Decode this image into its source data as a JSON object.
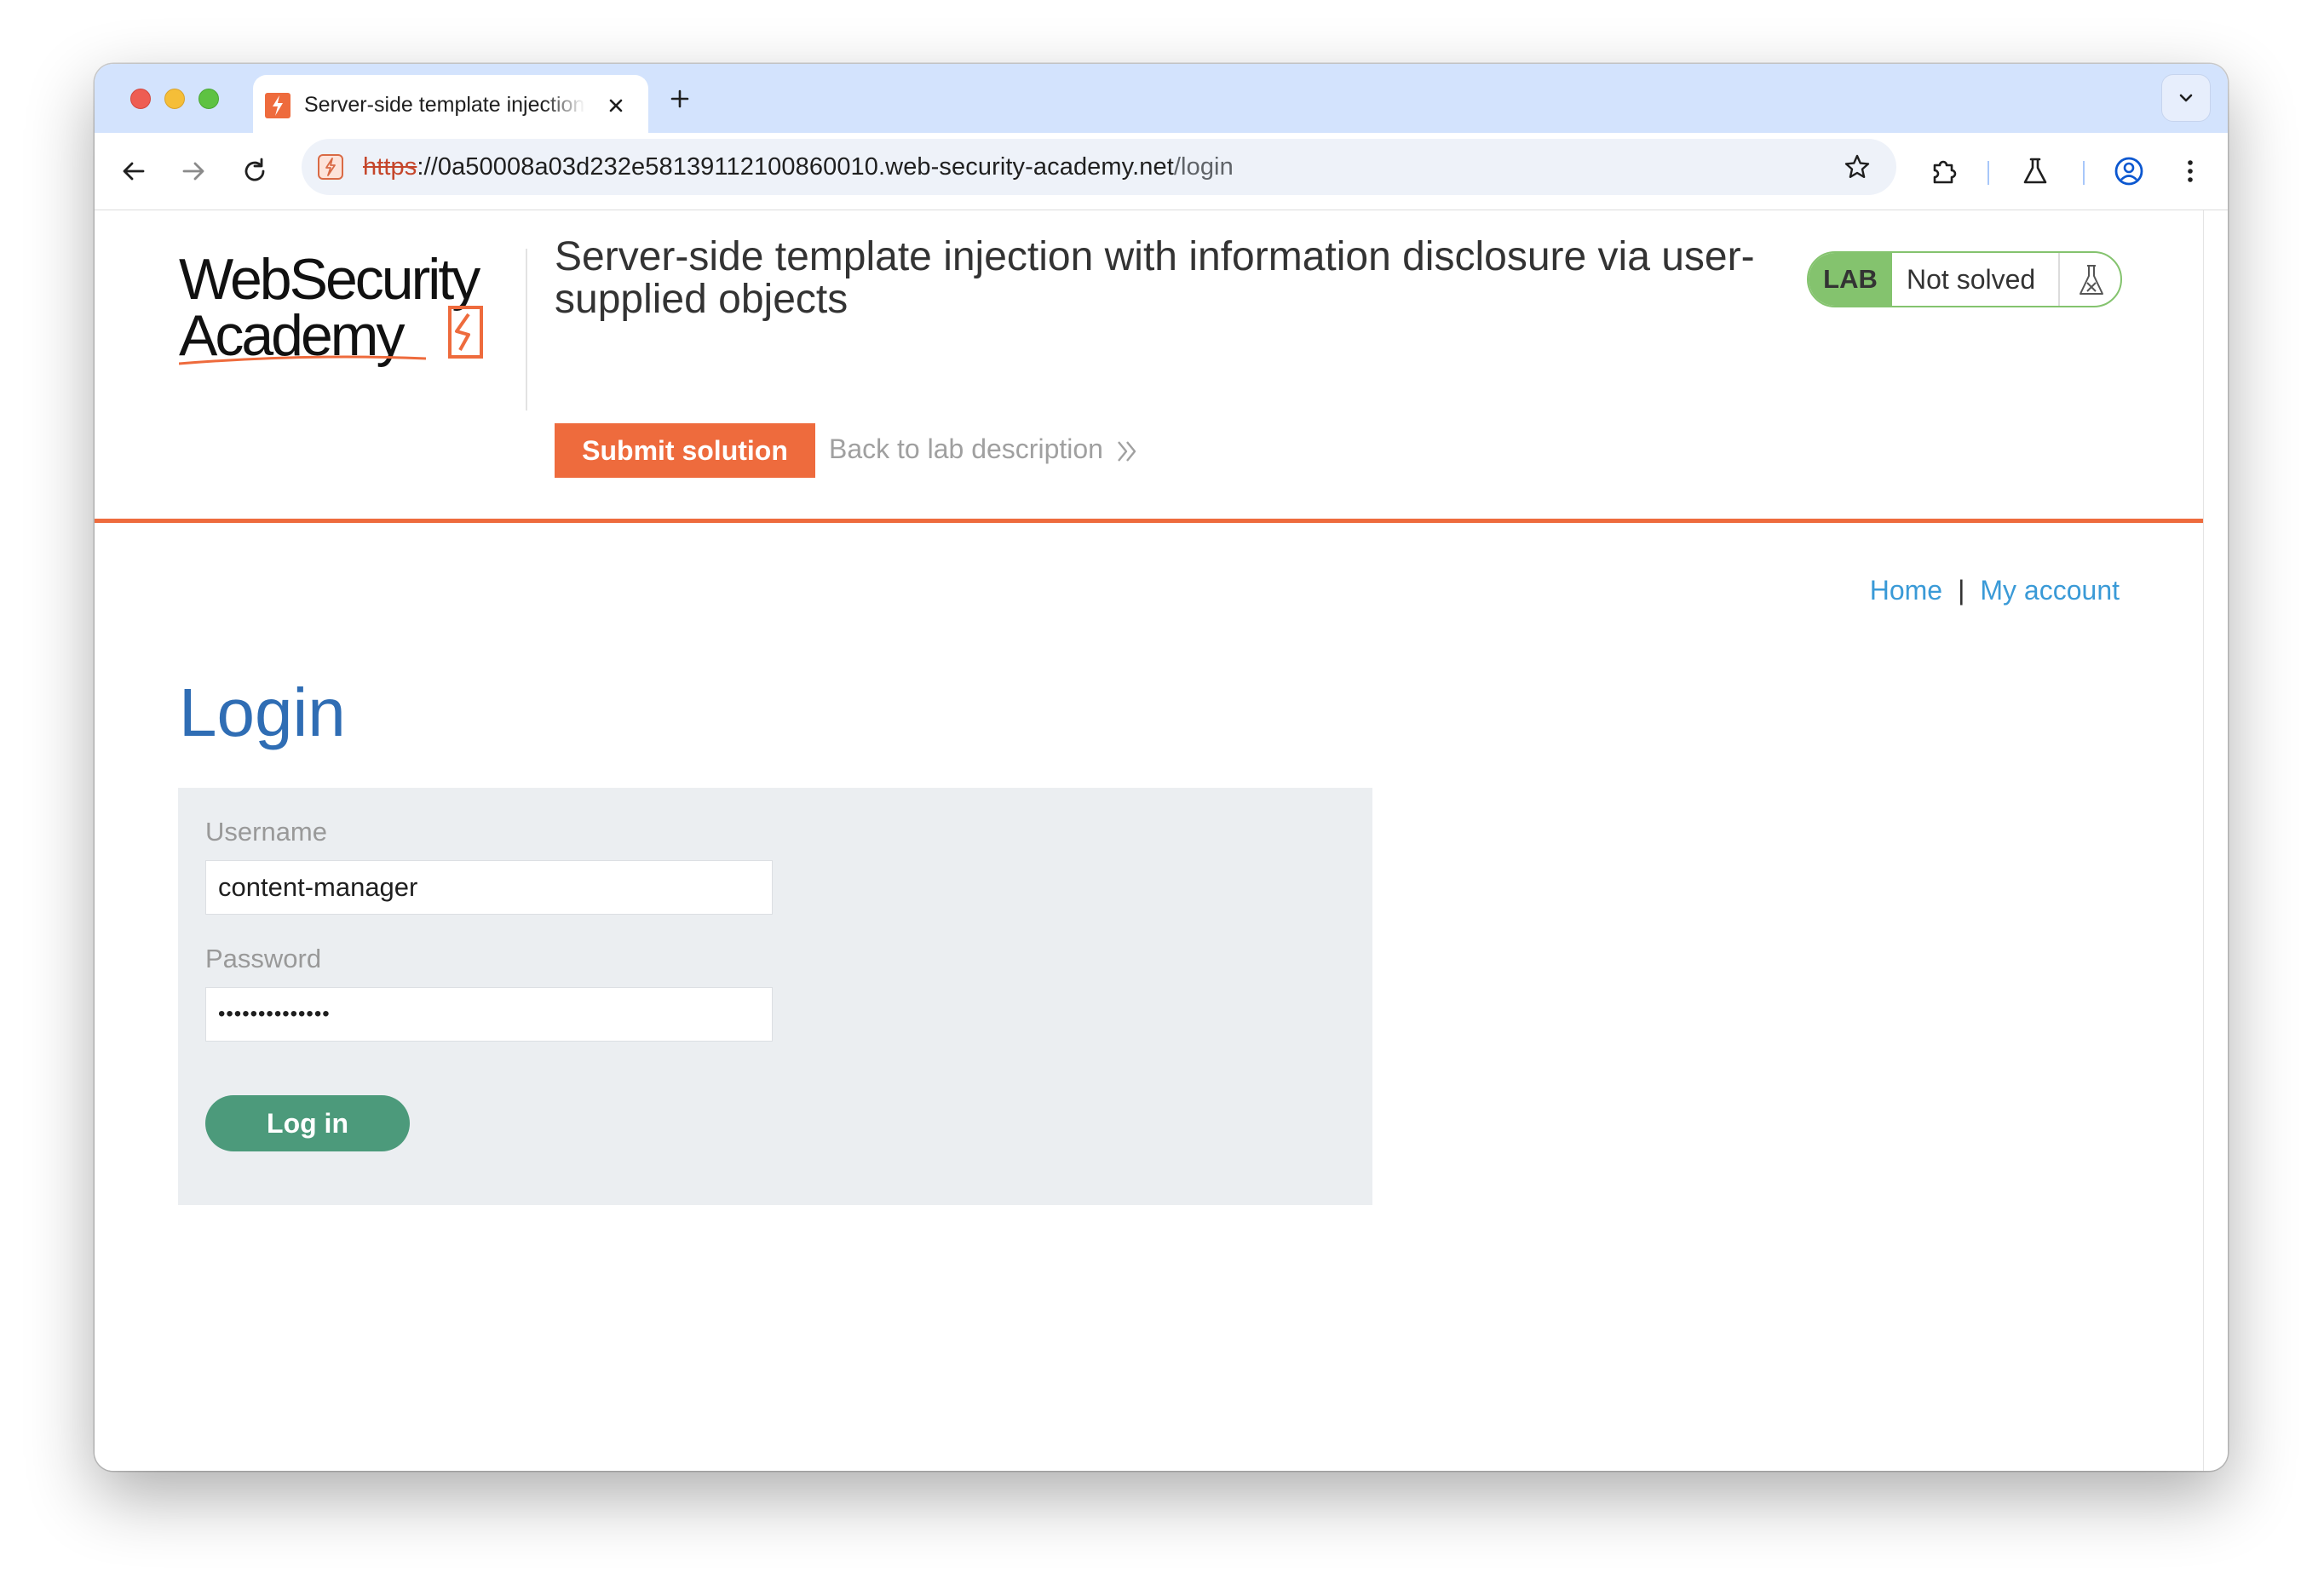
{
  "browser": {
    "tab_title": "Server-side template injection with information disclosure via user-supplied objects",
    "url_scheme": "https",
    "url_host": "://0a50008a03d232e58139112100860010.web-security-academy.net",
    "url_path": "/login"
  },
  "header": {
    "logo_line1": "WebSecurity",
    "logo_line2": "Academy",
    "lab_title": "Server-side template injection with information disclosure via user-supplied objects",
    "submit_label": "Submit solution",
    "back_label": "Back to lab description",
    "badge_label": "LAB",
    "badge_status": "Not solved"
  },
  "nav": {
    "home": "Home",
    "separator": "|",
    "my_account": "My account"
  },
  "login": {
    "heading": "Login",
    "username_label": "Username",
    "username_value": "content-manager",
    "password_label": "Password",
    "password_value": "••••••••••••••",
    "submit_label": "Log in"
  },
  "colors": {
    "accent_orange": "#ee6b3d",
    "heading_blue": "#2f6db4",
    "link_blue": "#3a9ad7",
    "login_green": "#4c9a7b",
    "badge_green": "#84c36e"
  }
}
